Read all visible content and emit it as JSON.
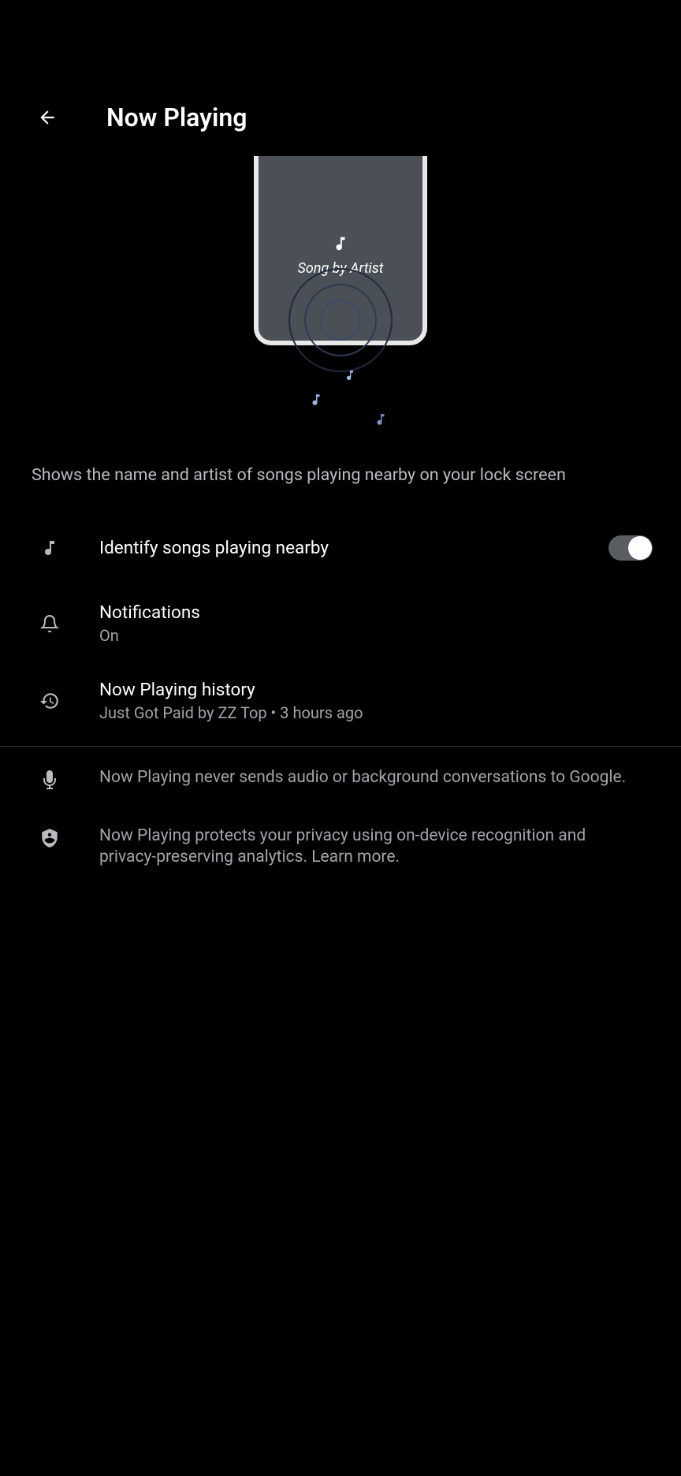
{
  "header": {
    "title": "Now Playing"
  },
  "illustration": {
    "song_label": "Song by Artist"
  },
  "description": "Shows the name and artist of songs playing nearby on your lock screen",
  "settings": {
    "identify": {
      "title": "Identify songs playing nearby",
      "enabled": true
    },
    "notifications": {
      "title": "Notifications",
      "value": "On"
    },
    "history": {
      "title": "Now Playing history",
      "value": "Just Got Paid by ZZ Top • 3 hours ago"
    }
  },
  "info": {
    "mic": "Now Playing never sends audio or background conversations to Google.",
    "privacy": "Now Playing protects your privacy using on-device recognition and privacy-preserving analytics. ",
    "learn_more": "Learn more."
  }
}
